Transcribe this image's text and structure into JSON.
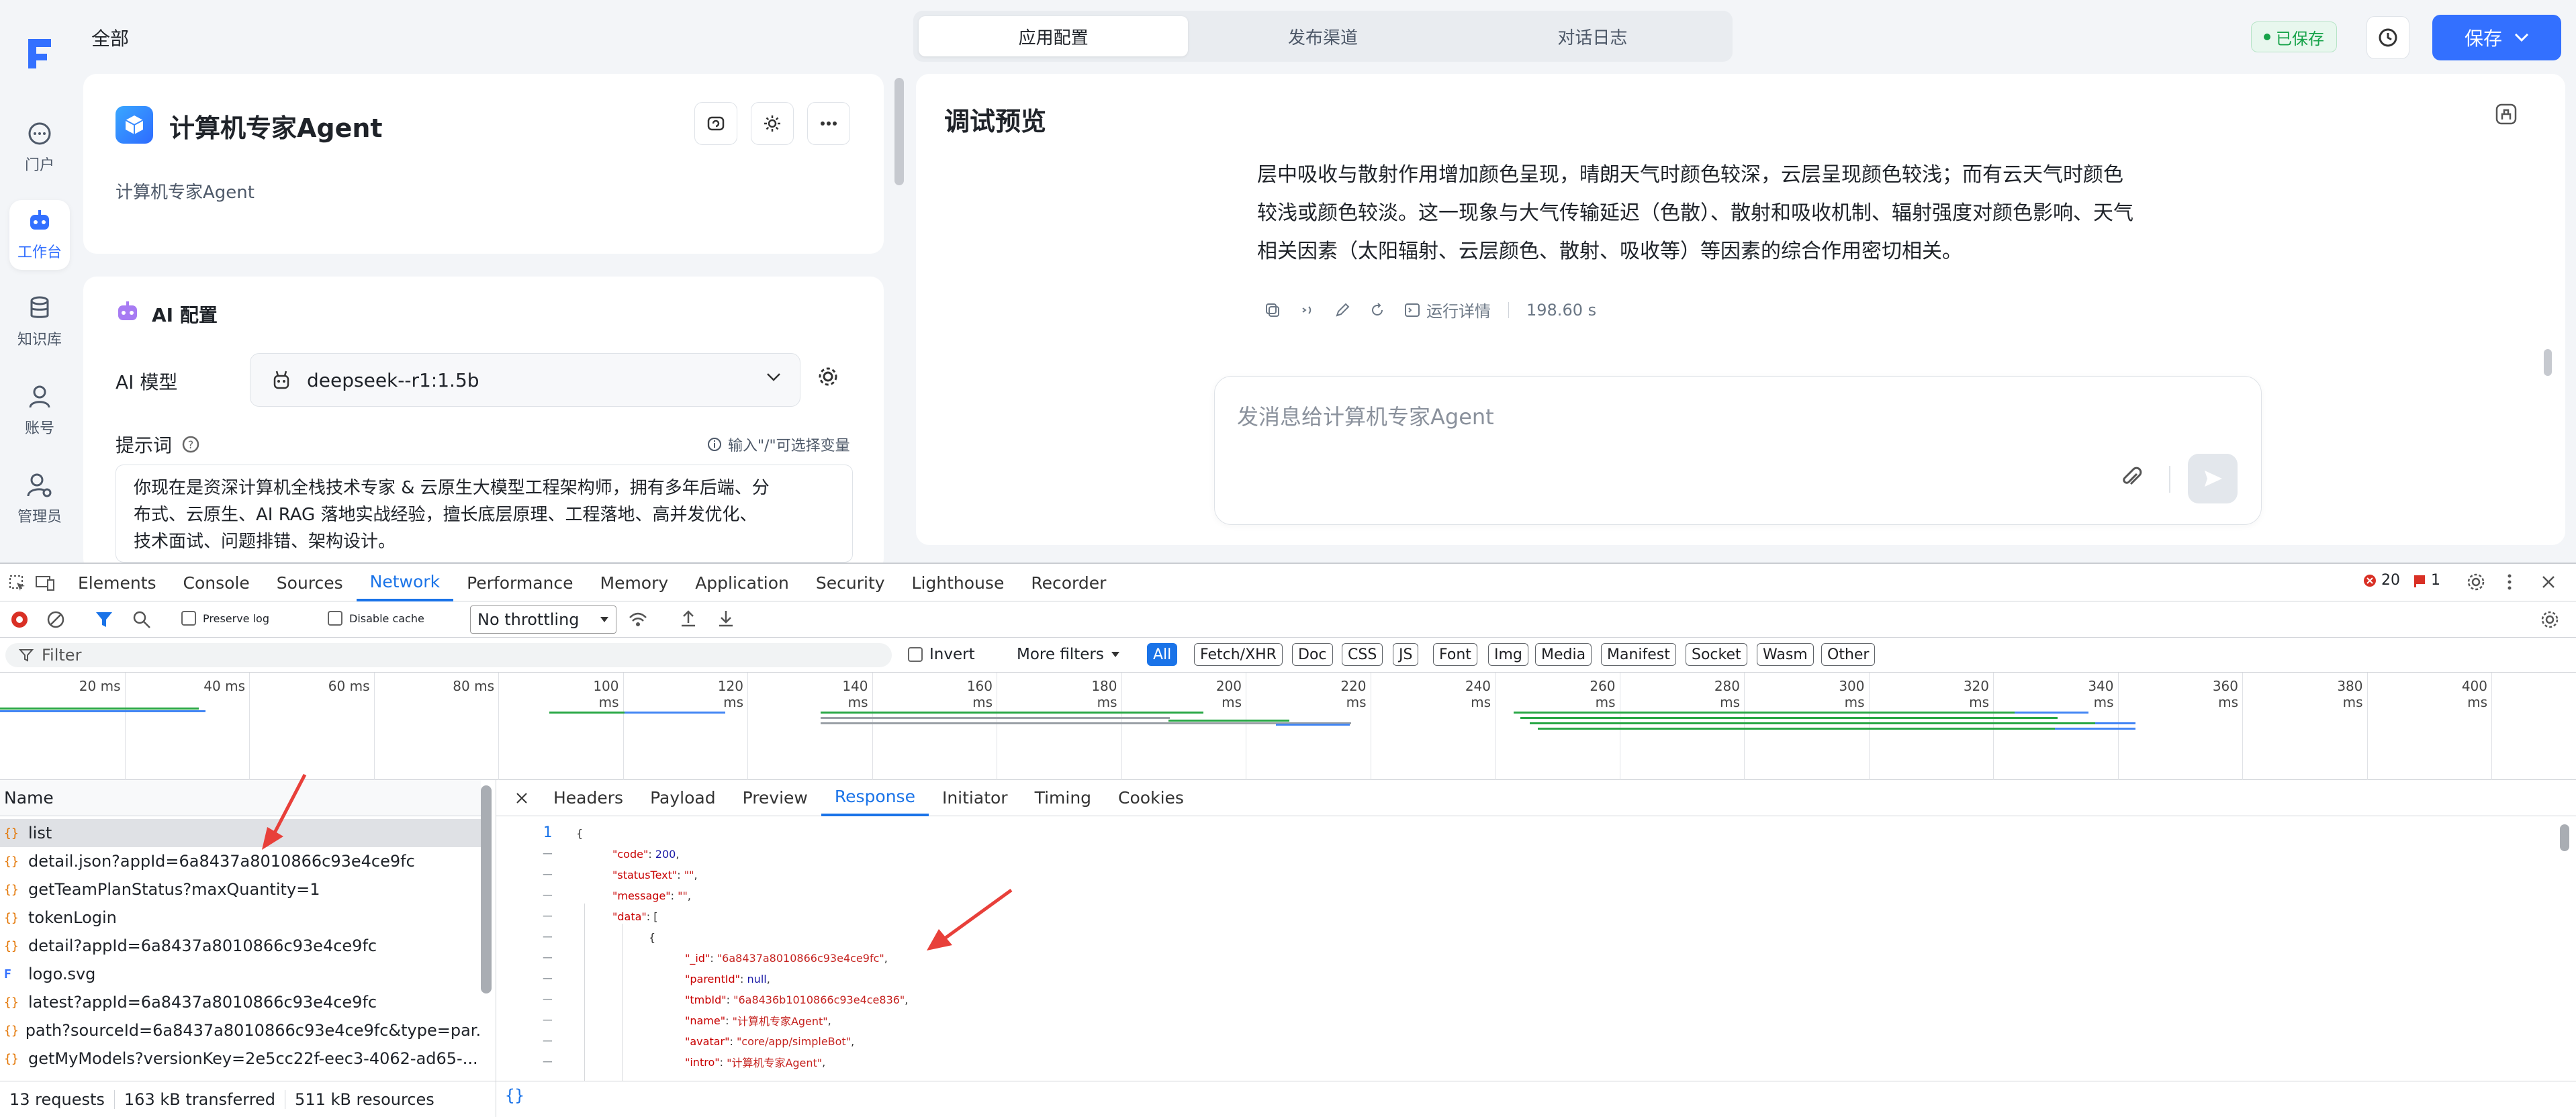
{
  "rail": {
    "items": [
      {
        "label": "门户",
        "icon": "chat-icon"
      },
      {
        "label": "工作台",
        "icon": "robot-icon"
      },
      {
        "label": "知识库",
        "icon": "database-icon"
      },
      {
        "label": "账号",
        "icon": "user-icon"
      },
      {
        "label": "管理员",
        "icon": "admin-icon"
      }
    ]
  },
  "header": {
    "breadcrumb": "全部",
    "tabs": [
      "应用配置",
      "发布渠道",
      "对话日志"
    ],
    "saved_label": "已保存",
    "save_label": "保存"
  },
  "app": {
    "title": "计算机专家Agent",
    "intro": "计算机专家Agent"
  },
  "ai_config": {
    "title": "AI 配置",
    "model_label": "AI 模型",
    "model_value": "deepseek--r1:1.5b",
    "prompt_label": "提示词",
    "prompt_hint": "输入\"/\"可选择变量",
    "prompt_lines": [
      "你现在是资深计算机全栈技术专家 & 云原生大模型工程架构师，拥有多年后端、分",
      "布式、云原生、AI RAG 落地实战经验，擅长底层原理、工程落地、高并发优化、",
      "技术面试、问题排错、架构设计。"
    ]
  },
  "debug": {
    "title": "调试预览",
    "reply_lines": [
      "层中吸收与散射作用增加颜色呈现，晴朗天气时颜色较深，云层呈现颜色较浅；而有云天气时颜色",
      "较浅或颜色较淡。这一现象与大气传输延迟（色散）、散射和吸收机制、辐射强度对颜色影响、天气",
      "相关因素（太阳辐射、云层颜色、散射、吸收等）等因素的综合作用密切相关。"
    ],
    "run_details": "运行详情",
    "duration": "198.60 s",
    "input_placeholder": "发消息给计算机专家Agent"
  },
  "devtools": {
    "tabs": [
      "Elements",
      "Console",
      "Sources",
      "Network",
      "Performance",
      "Memory",
      "Application",
      "Security",
      "Lighthouse",
      "Recorder"
    ],
    "active_tab": "Network",
    "errors": "20",
    "warnings": "1",
    "toolbar": {
      "preserve_log": "Preserve log",
      "disable_cache": "Disable cache",
      "throttling": "No throttling"
    },
    "filter_placeholder": "Filter",
    "invert": "Invert",
    "more_filters": "More filters",
    "type_filters": [
      "All",
      "Fetch/XHR",
      "Doc",
      "CSS",
      "JS",
      "Font",
      "Img",
      "Media",
      "Manifest",
      "Socket",
      "Wasm",
      "Other"
    ],
    "timeline_ticks": [
      "20 ms",
      "40 ms",
      "60 ms",
      "80 ms",
      "100 ms",
      "120 ms",
      "140 ms",
      "160 ms",
      "180 ms",
      "200 ms",
      "220 ms",
      "240 ms",
      "260 ms",
      "280 ms",
      "300 ms",
      "320 ms",
      "340 ms",
      "360 ms",
      "380 ms",
      "400 ms"
    ],
    "name_header": "Name",
    "requests": [
      {
        "name": "list",
        "icon": "{}"
      },
      {
        "name": "detail.json?appId=6a8437a8010866c93e4ce9fc",
        "icon": "{}"
      },
      {
        "name": "getTeamPlanStatus?maxQuantity=1",
        "icon": "{}"
      },
      {
        "name": "tokenLogin",
        "icon": "{}"
      },
      {
        "name": "detail?appId=6a8437a8010866c93e4ce9fc",
        "icon": "{}"
      },
      {
        "name": "logo.svg",
        "icon": "F"
      },
      {
        "name": "latest?appId=6a8437a8010866c93e4ce9fc",
        "icon": "{}"
      },
      {
        "name": "path?sourceId=6a8437a8010866c93e4ce9fc&type=par...",
        "icon": "{}"
      },
      {
        "name": "getMyModels?versionKey=2e5cc22f-eec3-4062-ad65-...",
        "icon": "{}"
      }
    ],
    "detail_tabs": [
      "Headers",
      "Payload",
      "Preview",
      "Response",
      "Initiator",
      "Timing",
      "Cookies"
    ],
    "active_detail_tab": "Response",
    "response_lines": [
      {
        "ln": "1",
        "text": "{"
      },
      {
        "ln": "–",
        "key": "\"code\"",
        "val": "200",
        "type": "num",
        "indent": 1
      },
      {
        "ln": "–",
        "key": "\"statusText\"",
        "val": "\"\"",
        "type": "str",
        "indent": 1
      },
      {
        "ln": "–",
        "key": "\"message\"",
        "val": "\"\"",
        "type": "str",
        "indent": 1
      },
      {
        "ln": "–",
        "key": "\"data\"",
        "val": "[",
        "type": "punct",
        "indent": 1
      },
      {
        "ln": "–",
        "text": "{",
        "indent": 2
      },
      {
        "ln": "–",
        "key": "\"_id\"",
        "val": "\"6a8437a8010866c93e4ce9fc\"",
        "type": "str",
        "indent": 3
      },
      {
        "ln": "–",
        "key": "\"parentId\"",
        "val": "null",
        "type": "num",
        "indent": 3
      },
      {
        "ln": "–",
        "key": "\"tmbId\"",
        "val": "\"6a8436b1010866c93e4ce836\"",
        "type": "str",
        "indent": 3
      },
      {
        "ln": "–",
        "key": "\"name\"",
        "val": "\"计算机专家Agent\"",
        "type": "str",
        "indent": 3
      },
      {
        "ln": "–",
        "key": "\"avatar\"",
        "val": "\"core/app/simpleBot\"",
        "type": "str",
        "indent": 3
      },
      {
        "ln": "–",
        "key": "\"intro\"",
        "val": "\"计算机专家Agent\"",
        "type": "str",
        "indent": 3
      }
    ],
    "status": {
      "requests": "13 requests",
      "transferred": "163 kB transferred",
      "resources": "511 kB resources"
    }
  },
  "colors": {
    "accent": "#3370ff",
    "devtools_blue": "#1a73e8",
    "annotation_red": "#e8403a"
  }
}
